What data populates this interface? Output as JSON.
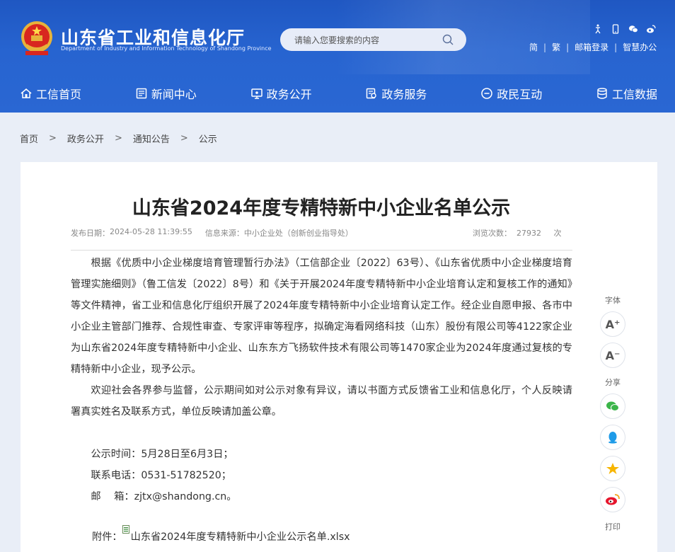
{
  "header": {
    "site_title": "山东省工业和信息化厅",
    "site_subtitle": "Department of Industry and Information Technology of Shandong Province",
    "search_placeholder": "请输入您要搜索的内容",
    "top_links": [
      "简",
      "繁",
      "邮箱登录",
      "智慧办公"
    ],
    "tool_icons": [
      "accessibility-icon",
      "mobile-icon",
      "wechat-icon",
      "weibo-icon"
    ],
    "brand_color": "#2562cc"
  },
  "nav": [
    {
      "label": "工信首页",
      "icon": "home-icon"
    },
    {
      "label": "新闻中心",
      "icon": "news-icon"
    },
    {
      "label": "政务公开",
      "icon": "monitor-icon"
    },
    {
      "label": "政务服务",
      "icon": "service-icon"
    },
    {
      "label": "政民互动",
      "icon": "chat-icon"
    },
    {
      "label": "工信数据",
      "icon": "database-icon"
    }
  ],
  "breadcrumb": [
    "首页",
    "政务公开",
    "通知公告",
    "公示"
  ],
  "breadcrumb_sep": ">",
  "article": {
    "title": "山东省2024年度专精特新中小企业名单公示",
    "publish_label": "发布日期：",
    "publish_date": "2024-05-28 11:39:55",
    "source_label": "信息来源：",
    "source": "中小企业处（创新创业指导处）",
    "views_label": "浏览次数：",
    "views": "27932",
    "views_unit": "次",
    "para1": "根据《优质中小企业梯度培育管理暂行办法》（工信部企业〔2022〕63号）、《山东省优质中小企业梯度培育管理实施细则》（鲁工信发〔2022〕8号）和《关于开展2024年度专精特新中小企业培育认定和复核工作的通知》等文件精神，省工业和信息化厅组织开展了2024年度专精特新中小企业培育认定工作。经企业自愿申报、各市中小企业主管部门推荐、合规性审查、专家评审等程序，拟确定海看网络科技（山东）股份有限公司等4122家企业为山东省2024年度专精特新中小企业、山东东方飞扬软件技术有限公司等1470家企业为2024年度通过复核的专精特新中小企业，现予公示。",
    "para2": "欢迎社会各界参与监督，公示期间如对公示对象有异议，请以书面方式反馈省工业和信息化厅，个人反映请署真实姓名及联系方式，单位反映请加盖公章。",
    "period": "公示时间：5月28日至6月3日；",
    "phone": "联系电话：0531-51782520；",
    "email": "邮　 箱：zjtx@shandong.cn。",
    "attach_label": "附件：",
    "attach_file": "山东省2024年度专精特新中小企业公示名单.xlsx"
  },
  "side_tools": {
    "font_label": "字体",
    "font_up": "A⁺",
    "font_down": "A⁻",
    "share_label": "分享",
    "share_icons": [
      "wechat-share-icon",
      "qq-share-icon",
      "qzone-share-icon",
      "weibo-share-icon"
    ],
    "print_label": "打印"
  }
}
